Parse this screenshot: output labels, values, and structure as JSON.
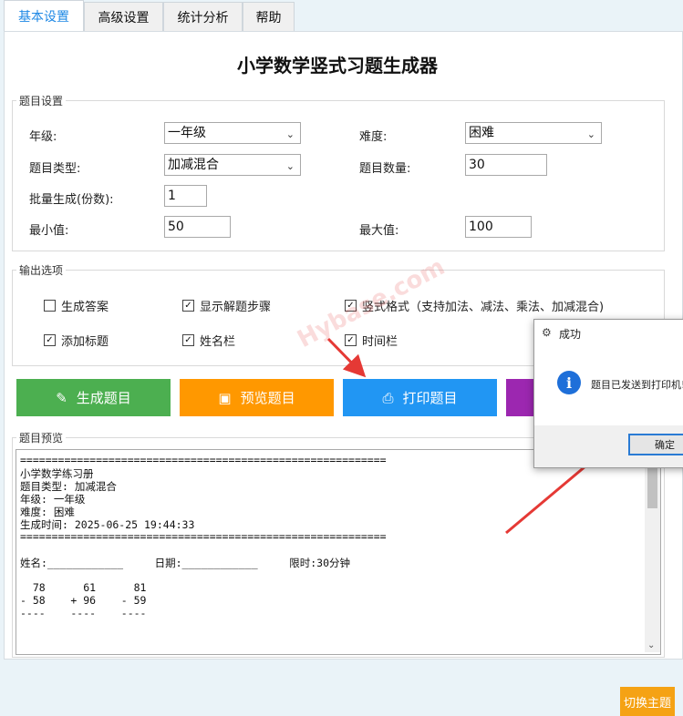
{
  "tabs": [
    "基本设置",
    "高级设置",
    "统计分析",
    "帮助"
  ],
  "title": "小学数学竖式习题生成器",
  "question_settings": {
    "legend": "题目设置",
    "grade_label": "年级:",
    "grade_value": "一年级",
    "difficulty_label": "难度:",
    "difficulty_value": "困难",
    "type_label": "题目类型:",
    "type_value": "加减混合",
    "count_label": "题目数量:",
    "count_value": "30",
    "batch_label": "批量生成(份数):",
    "batch_value": "1",
    "min_label": "最小值:",
    "min_value": "50",
    "max_label": "最大值:",
    "max_value": "100"
  },
  "output_options": {
    "legend": "输出选项",
    "items": [
      {
        "label": "生成答案",
        "checked": false
      },
      {
        "label": "显示解题步骤",
        "checked": true
      },
      {
        "label": "竖式格式（支持加法、减法、乘法、加减混合)",
        "checked": true
      },
      {
        "label": "添加标题",
        "checked": true
      },
      {
        "label": "姓名栏",
        "checked": true
      },
      {
        "label": "时间栏",
        "checked": true
      }
    ]
  },
  "buttons": {
    "generate": "生成题目",
    "preview": "预览题目",
    "print": "打印题目"
  },
  "colors": {
    "generate": "#4caf50",
    "preview": "#ff9800",
    "print": "#2196f3",
    "fourth": "#9c27b0",
    "theme": "#f5a214"
  },
  "preview": {
    "legend": "题目预览",
    "lines": [
      "==========================================================",
      "小学数学练习册",
      "题目类型: 加减混合",
      "年级: 一年级",
      "难度: 困难",
      "生成时间: 2025-06-25 19:44:33",
      "==========================================================",
      "",
      "姓名:____________     日期:____________     限时:30分钟",
      "",
      "  78      61      81",
      "- 58    + 96    - 59",
      "----    ----    ----"
    ]
  },
  "dialog": {
    "title": "成功",
    "message": "题目已发送到打印机!",
    "ok": "确定"
  },
  "watermark": "Hybase.com",
  "theme_button": "切换主题"
}
